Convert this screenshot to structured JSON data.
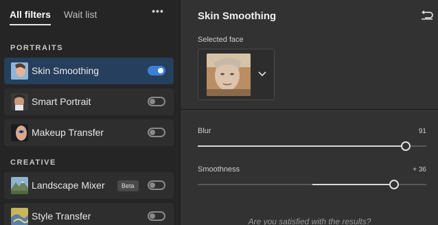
{
  "tabs": [
    {
      "label": "All filters",
      "active": true
    },
    {
      "label": "Wait list",
      "active": false
    }
  ],
  "more_icon": "ellipsis-icon",
  "more_text": "•••",
  "sections": {
    "portraits": "PORTRAITS",
    "creative": "CREATIVE"
  },
  "filters": [
    {
      "name": "Skin Smoothing",
      "enabled": true,
      "selected": true,
      "icon": "portrait-thumb"
    },
    {
      "name": "Smart Portrait",
      "enabled": false,
      "selected": false,
      "icon": "man-portrait-thumb"
    },
    {
      "name": "Makeup Transfer",
      "enabled": false,
      "selected": false,
      "icon": "eye-makeup-thumb"
    },
    {
      "name": "Landscape Mixer",
      "enabled": false,
      "selected": false,
      "badge": "Beta",
      "icon": "landscape-thumb"
    },
    {
      "name": "Style Transfer",
      "enabled": false,
      "selected": false,
      "icon": "style-thumb"
    }
  ],
  "panel": {
    "title": "Skin Smoothing",
    "reset_icon": "undo-icon",
    "selected_face_label": "Selected face",
    "sliders": [
      {
        "label": "Blur",
        "value_text": "91",
        "value": 91,
        "min": 0,
        "max": 100
      },
      {
        "label": "Smoothness",
        "value_text": "+ 36",
        "value": 36,
        "min": -50,
        "max": 50
      }
    ],
    "question": "Are you satisfied with the results?"
  },
  "colors": {
    "accent": "#3d7fd6",
    "selected_row": "#253f5c",
    "left_bg": "#252525",
    "right_bg": "#323232"
  }
}
